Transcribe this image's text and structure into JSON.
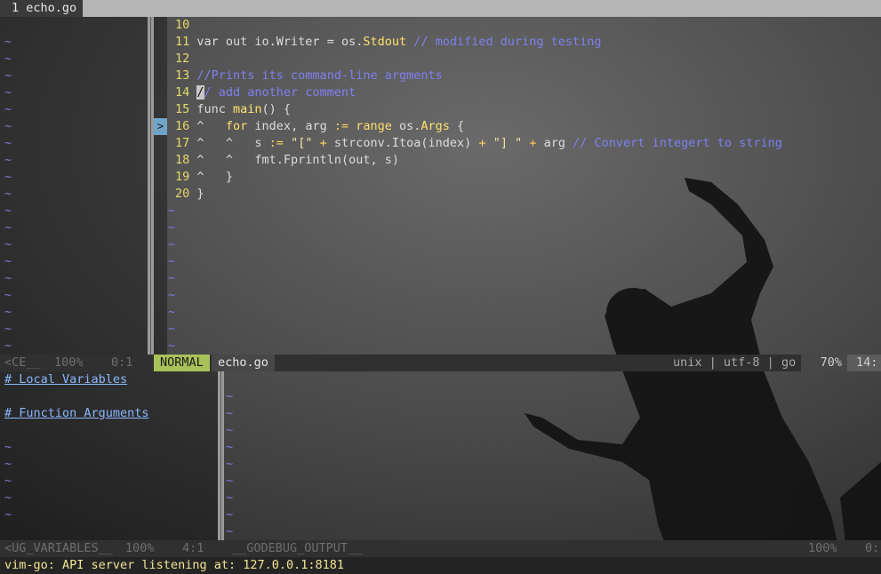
{
  "tabline": {
    "tab_number": "1",
    "tab_name": "echo.go"
  },
  "tagbar": {
    "tildes": 19
  },
  "code": [
    {
      "n": "10",
      "parts": []
    },
    {
      "n": "11",
      "parts": [
        [
          "pl",
          "var out io.Writer = os."
        ],
        [
          "fn",
          "Stdout"
        ],
        [
          "cmt",
          " // modified during testing"
        ]
      ]
    },
    {
      "n": "12",
      "parts": []
    },
    {
      "n": "13",
      "parts": [
        [
          "cmt",
          "//Prints its command-line argments"
        ]
      ]
    },
    {
      "n": "14",
      "parts": [
        [
          "cursor",
          "/"
        ],
        [
          "cmt",
          "/ add another comment"
        ]
      ]
    },
    {
      "n": "15",
      "parts": [
        [
          "pl",
          "func "
        ],
        [
          "fn",
          "main"
        ],
        [
          "pl",
          "() {"
        ]
      ]
    },
    {
      "n": "16",
      "parts": [
        [
          "pl",
          "^   "
        ],
        [
          "kw",
          "for"
        ],
        [
          "pl",
          " index, arg "
        ],
        [
          "op",
          ":="
        ],
        [
          "pl",
          " "
        ],
        [
          "kw",
          "range"
        ],
        [
          "pl",
          " os."
        ],
        [
          "fn",
          "Args"
        ],
        [
          "pl",
          " {"
        ]
      ]
    },
    {
      "n": "17",
      "parts": [
        [
          "pl",
          "^   ^   s "
        ],
        [
          "op",
          ":="
        ],
        [
          "pl",
          " "
        ],
        [
          "str",
          "\"[\""
        ],
        [
          "pl",
          " "
        ],
        [
          "op",
          "+"
        ],
        [
          "pl",
          " strconv.Itoa(index) "
        ],
        [
          "op",
          "+"
        ],
        [
          "pl",
          " "
        ],
        [
          "str",
          "\"] \""
        ],
        [
          "pl",
          " "
        ],
        [
          "op",
          "+"
        ],
        [
          "pl",
          " arg "
        ],
        [
          "cmt",
          "// Convert integert to string"
        ]
      ]
    },
    {
      "n": "18",
      "parts": [
        [
          "pl",
          "^   ^   fmt.Fprintln(out, s)"
        ]
      ]
    },
    {
      "n": "19",
      "parts": [
        [
          "pl",
          "^   }"
        ]
      ]
    },
    {
      "n": "20",
      "parts": [
        [
          "pl",
          "}"
        ]
      ]
    }
  ],
  "code_tildes": 9,
  "signs": {
    "breakpoint_glyph": ">"
  },
  "status_main": {
    "left_buffer": "<CE__",
    "left_percent": "100%",
    "left_pos": "0:1",
    "mode": "NORMAL",
    "filename": "echo.go",
    "fileformat": "unix",
    "encoding": "utf-8",
    "filetype": "go",
    "percent": "70%",
    "position": "14:"
  },
  "variables_pane": {
    "local_header": "# Local Variables",
    "args_header": "# Function Arguments",
    "tildes": 5
  },
  "output_pane": {
    "tildes": 9
  },
  "status_bottom": {
    "left_buffer": "<UG_VARIABLES__",
    "left_percent": "100%",
    "left_pos": "4:1",
    "right_buffer": "__GODEBUG_OUTPUT__",
    "right_percent": "100%",
    "right_pos": "0:"
  },
  "cmdline": {
    "text": "vim-go: API server listening at: 127.0.0.1:8181"
  },
  "colors": {
    "mode_badge": "#a9c159",
    "comment": "#7f80f0",
    "keyword": "#ffdf6b",
    "tilde": "#7b7bdc",
    "breakpoint_sign": "#6fa5c8"
  }
}
